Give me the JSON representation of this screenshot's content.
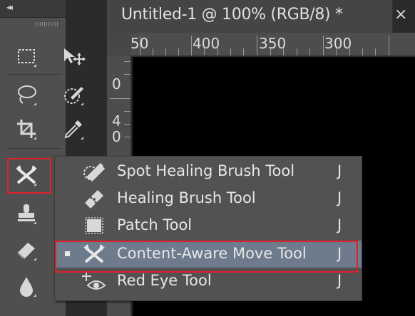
{
  "document": {
    "title": "Untitled-1 @ 100% (RGB/8) *",
    "close_label": "×"
  },
  "rulers": {
    "top_labels": [
      "50",
      "400",
      "350",
      "300"
    ],
    "left_labels": [
      "0",
      "4",
      "0"
    ]
  },
  "toolbar": {
    "collapse_label": "◂◂",
    "tools": [
      {
        "name": "marquee-tool",
        "icon": "dashed-rect-icon"
      },
      {
        "name": "move-tool",
        "icon": "move-arrow-icon"
      },
      {
        "name": "lasso-tool",
        "icon": "lasso-icon"
      },
      {
        "name": "quick-selection-tool",
        "icon": "brush-dashed-icon"
      },
      {
        "name": "crop-tool",
        "icon": "crop-icon"
      },
      {
        "name": "eyedropper-tool",
        "icon": "eyedropper-icon"
      },
      {
        "name": "content-aware-move-tool",
        "icon": "content-aware-move-icon"
      },
      {
        "name": "stamp-tool",
        "icon": "stamp-icon"
      },
      {
        "name": "eraser-tool",
        "icon": "eraser-icon"
      },
      {
        "name": "blur-tool",
        "icon": "drop-icon"
      }
    ]
  },
  "flyout": {
    "items": [
      {
        "label": "Spot Healing Brush Tool",
        "shortcut": "J",
        "icon": "spot-healing-brush-icon",
        "selected": false
      },
      {
        "label": "Healing Brush Tool",
        "shortcut": "J",
        "icon": "bandage-icon",
        "selected": false
      },
      {
        "label": "Patch Tool",
        "shortcut": "J",
        "icon": "patch-icon",
        "selected": false
      },
      {
        "label": "Content-Aware Move Tool",
        "shortcut": "J",
        "icon": "content-aware-move-icon",
        "selected": true
      },
      {
        "label": "Red Eye Tool",
        "shortcut": "J",
        "icon": "red-eye-icon",
        "selected": false
      }
    ]
  },
  "colors": {
    "highlight_border": "#e0202a",
    "selected_row": "#6e7b8c"
  }
}
